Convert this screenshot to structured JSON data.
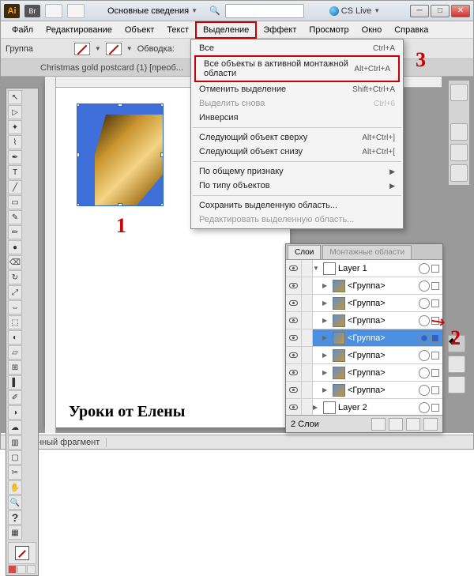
{
  "titlebar": {
    "app_logo": "Ai",
    "br_badge": "Br",
    "workspace_label": "Основные сведения",
    "cslive_label": "CS Live"
  },
  "menubar": {
    "items": [
      "Файл",
      "Редактирование",
      "Объект",
      "Текст",
      "Выделение",
      "Эффект",
      "Просмотр",
      "Окно",
      "Справка"
    ]
  },
  "controlbar": {
    "group_label": "Группа",
    "stroke_label": "Обводка:"
  },
  "doctab": {
    "title": "Christmas gold postcard (1) [преоб..."
  },
  "dropdown": {
    "items": [
      {
        "label": "Все",
        "shortcut": "Ctrl+A",
        "enabled": true,
        "boxed": false,
        "sub": false
      },
      {
        "label": "Все объекты в активной монтажной области",
        "shortcut": "Alt+Ctrl+A",
        "enabled": true,
        "boxed": true,
        "sub": false
      },
      {
        "label": "Отменить выделение",
        "shortcut": "Shift+Ctrl+A",
        "enabled": true,
        "boxed": false,
        "sub": false
      },
      {
        "label": "Выделить снова",
        "shortcut": "Ctrl+6",
        "enabled": false,
        "boxed": false,
        "sub": false
      },
      {
        "label": "Инверсия",
        "shortcut": "",
        "enabled": true,
        "boxed": false,
        "sub": false
      },
      {
        "sep": true
      },
      {
        "label": "Следующий объект сверху",
        "shortcut": "Alt+Ctrl+]",
        "enabled": true,
        "boxed": false,
        "sub": false
      },
      {
        "label": "Следующий объект снизу",
        "shortcut": "Alt+Ctrl+[",
        "enabled": true,
        "boxed": false,
        "sub": false
      },
      {
        "sep": true
      },
      {
        "label": "По общему признаку",
        "shortcut": "",
        "enabled": true,
        "boxed": false,
        "sub": true
      },
      {
        "label": "По типу объектов",
        "shortcut": "",
        "enabled": true,
        "boxed": false,
        "sub": true
      },
      {
        "sep": true
      },
      {
        "label": "Сохранить выделенную область...",
        "shortcut": "",
        "enabled": true,
        "boxed": false,
        "sub": false
      },
      {
        "label": "Редактировать выделенную область...",
        "shortcut": "",
        "enabled": false,
        "boxed": false,
        "sub": false
      }
    ]
  },
  "layers": {
    "tab_layers": "Слои",
    "tab_artboards": "Монтажные области",
    "rows": [
      {
        "name": "Layer 1",
        "indent": 0,
        "twisty": "▼",
        "thumb": "empty",
        "selected": false,
        "selbox": false,
        "target": false
      },
      {
        "name": "<Группа>",
        "indent": 1,
        "twisty": "▶",
        "thumb": "img",
        "selected": false,
        "selbox": false,
        "target": false
      },
      {
        "name": "<Группа>",
        "indent": 1,
        "twisty": "▶",
        "thumb": "img",
        "selected": false,
        "selbox": false,
        "target": false
      },
      {
        "name": "<Группа>",
        "indent": 1,
        "twisty": "▶",
        "thumb": "img",
        "selected": false,
        "selbox": false,
        "target": false
      },
      {
        "name": "<Группа>",
        "indent": 1,
        "twisty": "▶",
        "thumb": "img",
        "selected": true,
        "selbox": true,
        "target": true
      },
      {
        "name": "<Группа>",
        "indent": 1,
        "twisty": "▶",
        "thumb": "img",
        "selected": false,
        "selbox": false,
        "target": false
      },
      {
        "name": "<Группа>",
        "indent": 1,
        "twisty": "▶",
        "thumb": "img",
        "selected": false,
        "selbox": false,
        "target": false
      },
      {
        "name": "<Группа>",
        "indent": 1,
        "twisty": "▶",
        "thumb": "img",
        "selected": false,
        "selbox": false,
        "target": false
      },
      {
        "name": "Layer 2",
        "indent": 0,
        "twisty": "▶",
        "thumb": "empty",
        "selected": false,
        "selbox": false,
        "target": false
      }
    ],
    "status": "2 Слои"
  },
  "annotations": {
    "num1": "1",
    "num2": "2",
    "num3": "3"
  },
  "watermark": "Уроки от Елены",
  "statusbar": {
    "fragment": "Выделенный фрагмент"
  }
}
